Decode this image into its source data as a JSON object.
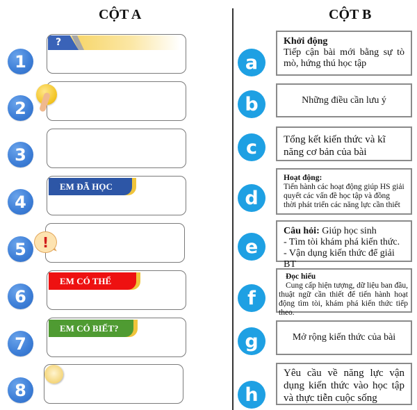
{
  "column_a": {
    "title": "CỘT A",
    "items": [
      {
        "number": "1",
        "icon": "question-banner-icon",
        "banner_text": "?"
      },
      {
        "number": "2",
        "icon": "lightbulb-touch-icon"
      },
      {
        "number": "3",
        "icon": null
      },
      {
        "number": "4",
        "icon": "banner",
        "banner_text": "EM ĐÃ HỌC",
        "banner_color": "#2d56a6"
      },
      {
        "number": "5",
        "icon": "exclamation-bubble-icon",
        "banner_text": "!"
      },
      {
        "number": "6",
        "icon": "banner",
        "banner_text": "EM CÓ THỂ",
        "banner_color": "#ee1111"
      },
      {
        "number": "7",
        "icon": "banner",
        "banner_text": "EM CÓ BIẾT?",
        "banner_color": "#4f9b32"
      },
      {
        "number": "8",
        "icon": "hand-coin-icon"
      }
    ]
  },
  "column_b": {
    "title": "CỘT B",
    "items": [
      {
        "letter": "a",
        "heading": "Khởi động",
        "text": "Tiếp cận bài mới bằng sự tò mò, hứng thú học tập"
      },
      {
        "letter": "b",
        "text": "Những điều cần lưu ý"
      },
      {
        "letter": "c",
        "text": "Tổng kết kiến thức và kĩ năng cơ bản của bài"
      },
      {
        "letter": "d",
        "heading": "Hoạt động:",
        "text": "Tiến hành các hoạt động giúp HS giải quyết các vấn đề học tập và đồng thời phát triển các năng lực cần thiết"
      },
      {
        "letter": "e",
        "heading": "Câu hỏi:",
        "heading_suffix": " Giúp học sinh",
        "lines": [
          "- Tìm tòi khám phá kiến thức.",
          "- Vận dụng kiến thức để giải BT"
        ]
      },
      {
        "letter": "f",
        "heading": "Đọc hiểu",
        "text": "Cung cấp hiện tượng, dữ liệu ban đầu, thuật ngữ cần thiết để tiến hành hoạt động tìm tòi, khám phá kiến thức tiếp theo."
      },
      {
        "letter": "g",
        "text": "Mở rộng kiến thức của bài"
      },
      {
        "letter": "h",
        "text": "Yêu cầu về năng lực vận dụng kiến thức vào học tập và thực tiễn cuộc sống"
      }
    ]
  },
  "colors": {
    "number_badge": "#3f80d8",
    "letter_badge": "#1ea0e3",
    "banner_gold": "#f0c43b"
  }
}
